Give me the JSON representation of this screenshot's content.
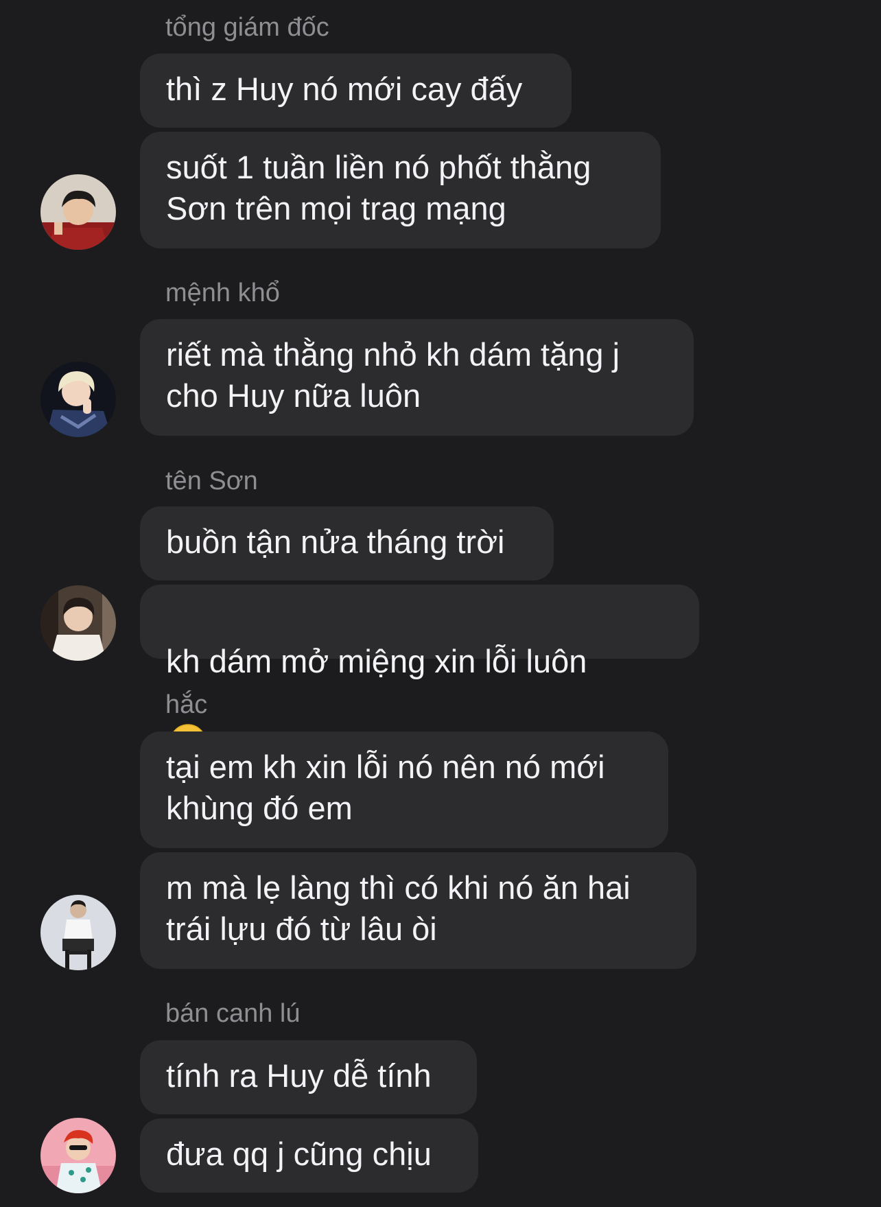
{
  "messages": [
    {
      "sender": "tổng giám đốc",
      "bubbles": [
        "thì z Huy nó mới cay đấy",
        "suốt 1 tuần liền nó phốt thằng\nSơn trên mọi trag mạng"
      ]
    },
    {
      "sender": "mệnh khổ",
      "bubbles": [
        "riết mà thằng nhỏ kh dám tặng j\ncho Huy nữa luôn"
      ]
    },
    {
      "sender": "tên Sơn",
      "bubbles": [
        "buồn tận nửa tháng trời",
        "kh dám mở miệng xin lỗi luôn"
      ]
    },
    {
      "sender": "hắc",
      "bubbles": [
        "tại em kh xin lỗi nó nên nó mới\nkhùng đó em",
        "m mà lẹ làng thì có khi nó ăn hai\ntrái lựu đó từ lâu òi"
      ]
    },
    {
      "sender": "bán canh lú",
      "bubbles": [
        "tính ra Huy dễ tính",
        "đưa qq j cũng chịu"
      ]
    }
  ],
  "icons": {
    "tear_emoji": "face-holding-back-tears-icon"
  },
  "colors": {
    "background": "#1c1c1e",
    "bubble": "#2c2c2e",
    "text": "#f2f2f7",
    "sender": "#8e8e93"
  }
}
